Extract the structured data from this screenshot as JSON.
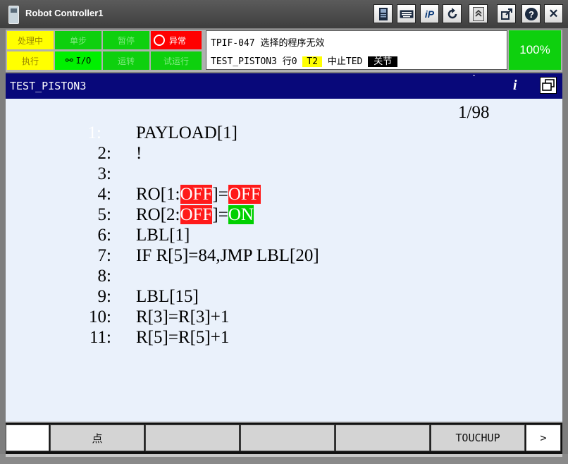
{
  "window": {
    "title": "Robot Controller1"
  },
  "toolbar_icons": [
    "teach-pendant-icon",
    "keyboard-icon",
    "ip-icon",
    "refresh-icon",
    "jog-icon",
    "resize-icon",
    "help-icon",
    "close-icon"
  ],
  "toolbar_labels": {
    "ip": "iP",
    "help": "?",
    "close": "✕"
  },
  "status": {
    "row1": [
      {
        "label": "处理中",
        "color": "yellow"
      },
      {
        "label": "单步",
        "color": "green"
      },
      {
        "label": "暂停",
        "color": "green"
      },
      {
        "label": "异常",
        "color": "red"
      }
    ],
    "row2": [
      {
        "label": "执行",
        "color": "yellow"
      },
      {
        "label": "I/O",
        "color": "yellow"
      },
      {
        "label": "运转",
        "color": "green"
      },
      {
        "label": "试运行",
        "color": "green"
      }
    ],
    "message_line1": "TPIF-047 选择的程序无效",
    "message_line2_prefix": "TEST_PISTON3 行0 ",
    "message_mode": "T2",
    "message_state": " 中止TED ",
    "message_joint": "关节",
    "speed_override": "100%"
  },
  "program": {
    "name": "TEST_PISTON3",
    "page_indicator": "1/98",
    "current_line": 1,
    "lines": [
      {
        "num": "1:",
        "code": "PAYLOAD[1]"
      },
      {
        "num": "2:",
        "code": "!"
      },
      {
        "num": "3:",
        "code": ""
      },
      {
        "num": "4:",
        "code_pre": "RO[1:",
        "code_hl1": "OFF",
        "code_mid": "]=",
        "code_hl2": "OFF",
        "code_post": ""
      },
      {
        "num": "5:",
        "code_pre": "RO[2:",
        "code_hl1": "OFF",
        "code_mid": "]=",
        "code_hl2": "ON",
        "code_post": ""
      },
      {
        "num": "6:",
        "code": "LBL[1]"
      },
      {
        "num": "7:",
        "code": "IF R[5]=84,JMP LBL[20]"
      },
      {
        "num": "8:",
        "code": ""
      },
      {
        "num": "9:",
        "code": "LBL[15]"
      },
      {
        "num": "10:",
        "code": "R[3]=R[3]+1"
      },
      {
        "num": "11:",
        "code": "R[5]=R[5]+1"
      }
    ]
  },
  "function_keys": [
    "",
    "点",
    "",
    "",
    "",
    "TOUCHUP",
    ">"
  ],
  "colors": {
    "title_bar": "#4a4a4a",
    "prog_header": "#08087a",
    "editor_bg": "#eaf1fb",
    "status_green": "#0ed00e",
    "status_yellow": "#ffff00",
    "alarm_red": "#ff1a1a"
  }
}
